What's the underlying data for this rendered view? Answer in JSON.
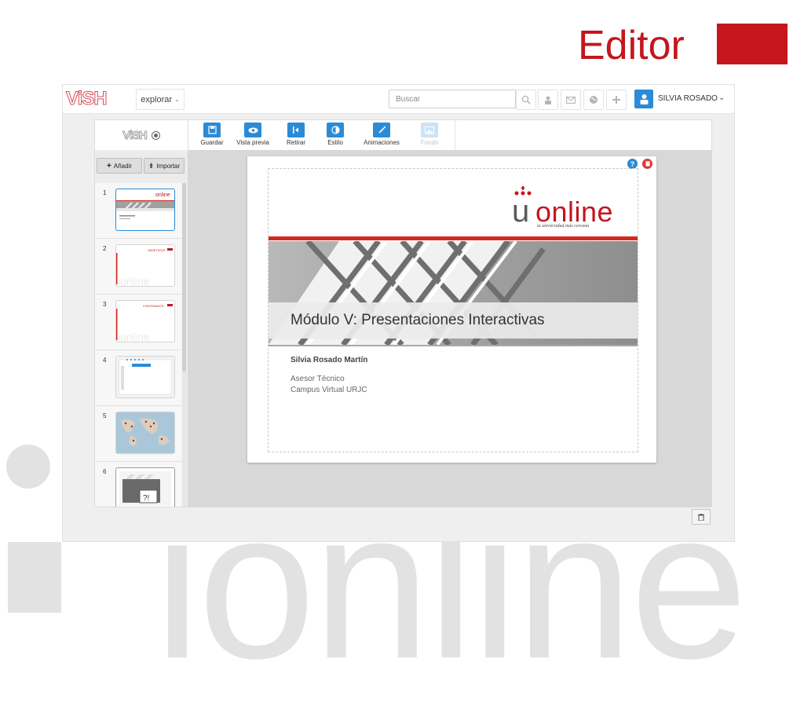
{
  "slide": {
    "title": "Editor",
    "accent_color": "#c4161c",
    "watermark_text": "ionline"
  },
  "app": {
    "brand": "ViSH",
    "explore_label": "explorar",
    "search": {
      "placeholder": "Buscar",
      "value": ""
    },
    "toolbar_icons": [
      "search-icon",
      "user-icon",
      "mail-icon",
      "globe-icon",
      "plus-icon"
    ],
    "user": {
      "name": "SILVIA ROSADO"
    }
  },
  "editor": {
    "brand": "ViSH",
    "tools": [
      {
        "label": "Guardar",
        "icon": "save-icon",
        "enabled": true
      },
      {
        "label": "Vista previa",
        "icon": "eye-icon",
        "enabled": true
      },
      {
        "label": "Retirar",
        "icon": "exit-icon",
        "enabled": true
      },
      {
        "label": "Estilo",
        "icon": "contrast-icon",
        "enabled": true
      },
      {
        "label": "Animaciones",
        "icon": "wand-icon",
        "enabled": true
      },
      {
        "label": "Fondo",
        "icon": "image-icon",
        "enabled": false
      }
    ],
    "sidebar": {
      "add_label": "Añadir",
      "import_label": "Importar",
      "thumbnails": [
        {
          "number": "1",
          "label": "",
          "selected": true
        },
        {
          "number": "2",
          "label": "OBJETIVOS",
          "selected": false
        },
        {
          "number": "3",
          "label": "CONTENIDOS",
          "selected": false
        },
        {
          "number": "4",
          "label": "",
          "selected": false
        },
        {
          "number": "5",
          "label": "",
          "selected": false
        },
        {
          "number": "6",
          "label": "",
          "selected": false
        }
      ]
    },
    "slide": {
      "logo_u": "u",
      "logo_word": "online",
      "tagline": "tu universidad más cercana",
      "heading": "Módulo V: Presentaciones Interactivas",
      "author": "Silvia Rosado Martín",
      "role": "Asesor Técnico",
      "campus": "Campus Virtual URJC"
    }
  }
}
